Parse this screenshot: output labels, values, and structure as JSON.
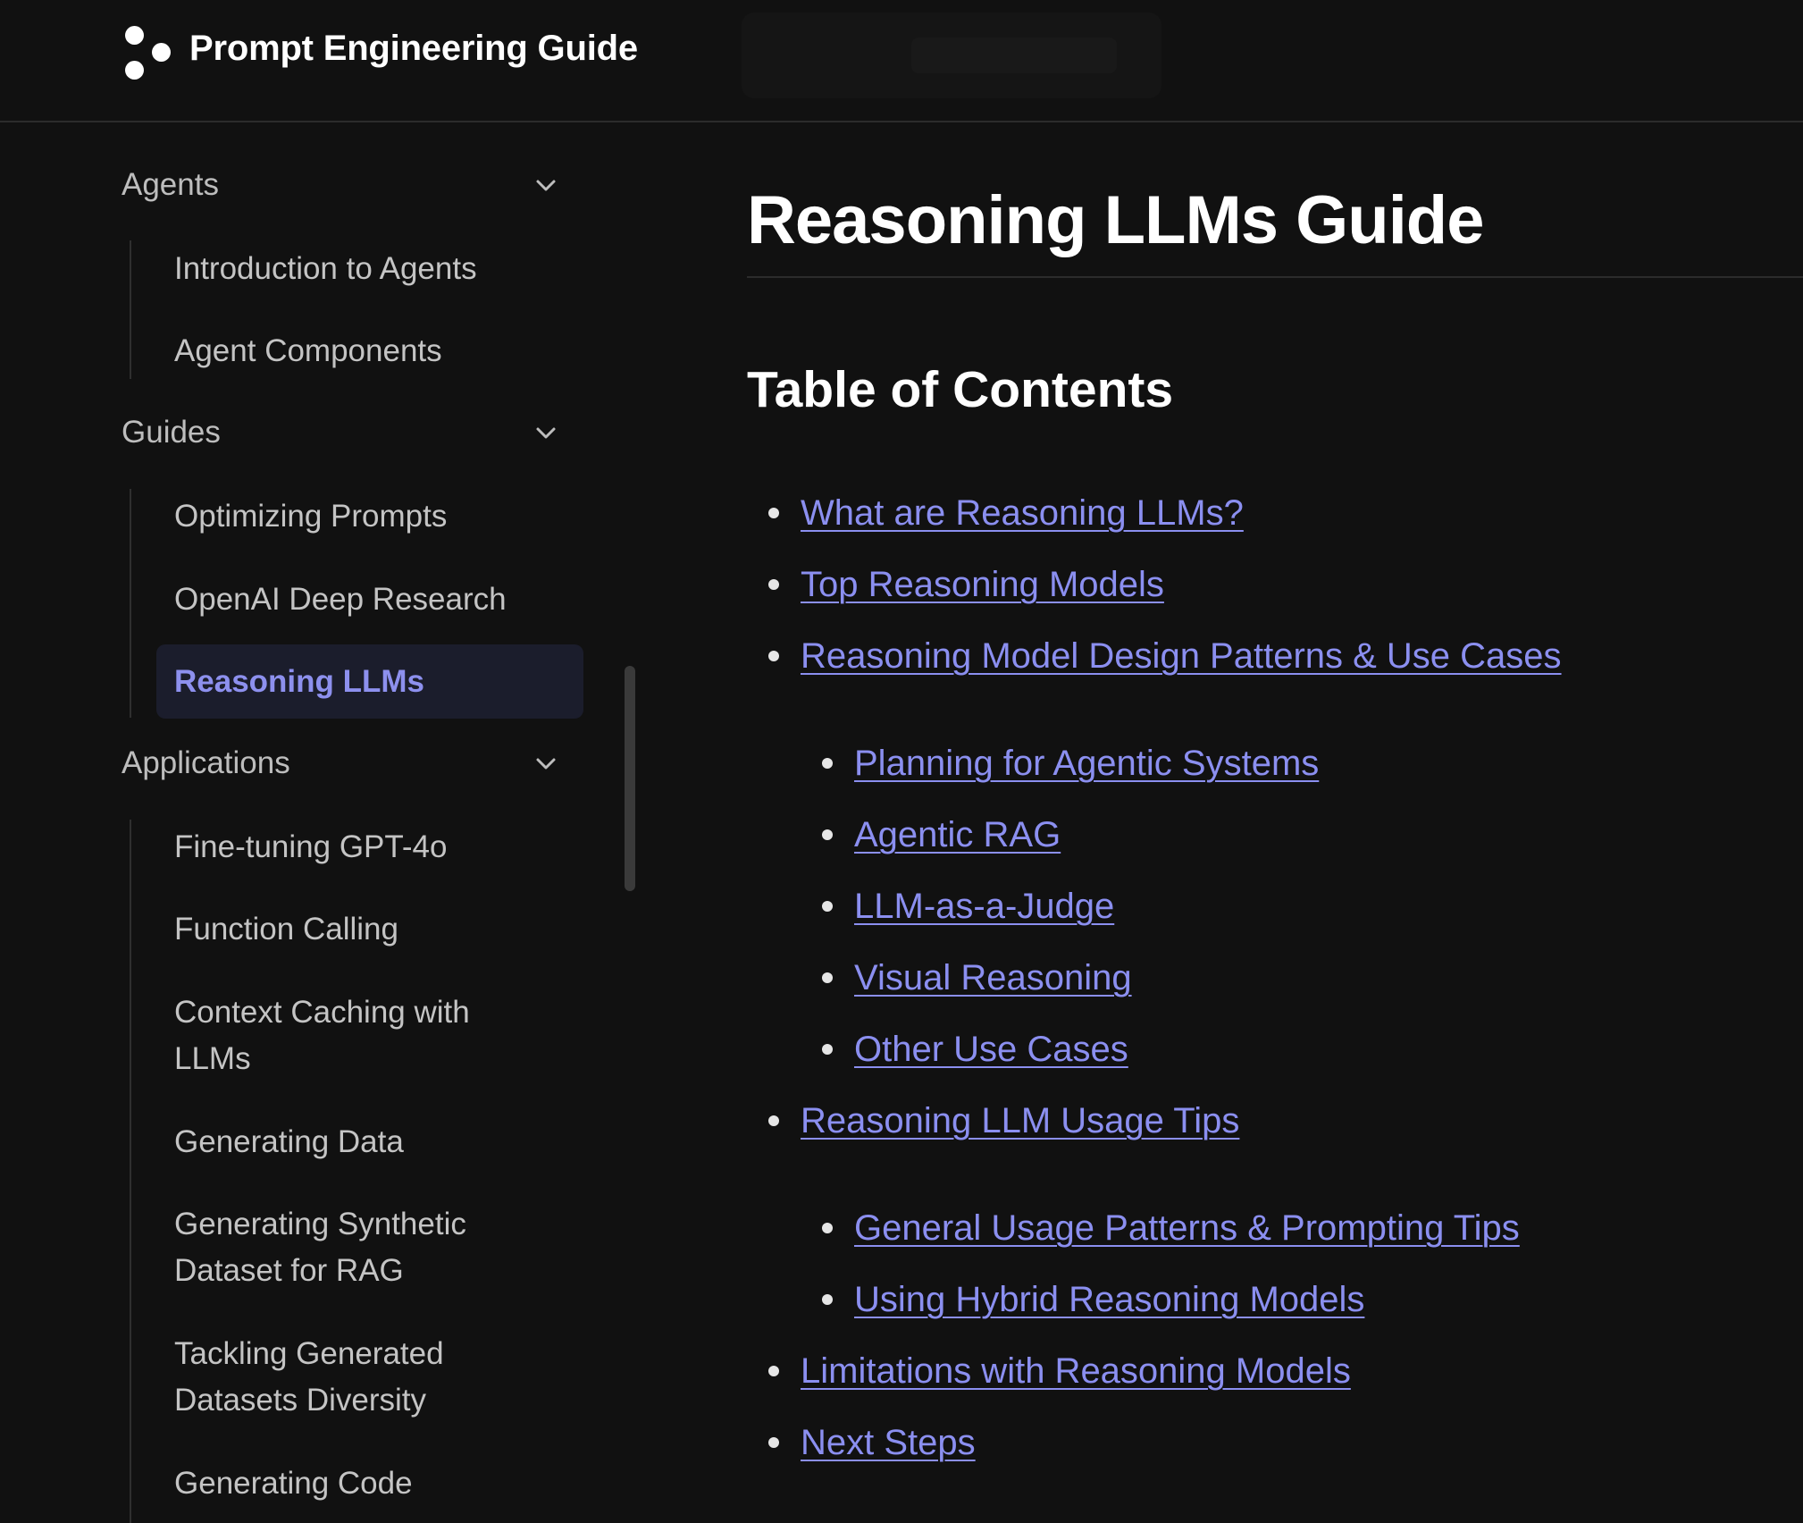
{
  "header": {
    "brand": "Prompt Engineering Guide"
  },
  "sidebar": {
    "sections": [
      {
        "title": "Agents",
        "items": [
          "Introduction to Agents",
          "Agent Components"
        ]
      },
      {
        "title": "Guides",
        "items": [
          "Optimizing Prompts",
          "OpenAI Deep Research",
          "Reasoning LLMs"
        ],
        "active_item": "Reasoning LLMs"
      },
      {
        "title": "Applications",
        "items": [
          "Fine-tuning GPT-4o",
          "Function Calling",
          "Context Caching with LLMs",
          "Generating Data",
          "Generating Synthetic Dataset for RAG",
          "Tackling Generated Datasets Diversity",
          "Generating Code"
        ]
      }
    ]
  },
  "main": {
    "title": "Reasoning LLMs Guide",
    "toc_title": "Table of Contents",
    "toc": [
      {
        "label": "What are Reasoning LLMs?",
        "level": 1
      },
      {
        "label": "Top Reasoning Models",
        "level": 1
      },
      {
        "label": "Reasoning Model Design Patterns & Use Cases",
        "level": 1
      },
      {
        "label": "Planning for Agentic Systems",
        "level": 2
      },
      {
        "label": "Agentic RAG",
        "level": 2
      },
      {
        "label": "LLM-as-a-Judge",
        "level": 2
      },
      {
        "label": "Visual Reasoning",
        "level": 2
      },
      {
        "label": "Other Use Cases",
        "level": 2
      },
      {
        "label": "Reasoning LLM Usage Tips",
        "level": 1
      },
      {
        "label": "General Usage Patterns & Prompting Tips",
        "level": 2
      },
      {
        "label": "Using Hybrid Reasoning Models",
        "level": 2
      },
      {
        "label": "Limitations with Reasoning Models",
        "level": 1
      },
      {
        "label": "Next Steps",
        "level": 1
      }
    ]
  },
  "colors": {
    "background": "#111111",
    "link": "#8b8ff0",
    "active_bg": "#1b1d2c"
  },
  "icons": [
    "logo-dots-icon",
    "chevron-down-icon"
  ]
}
